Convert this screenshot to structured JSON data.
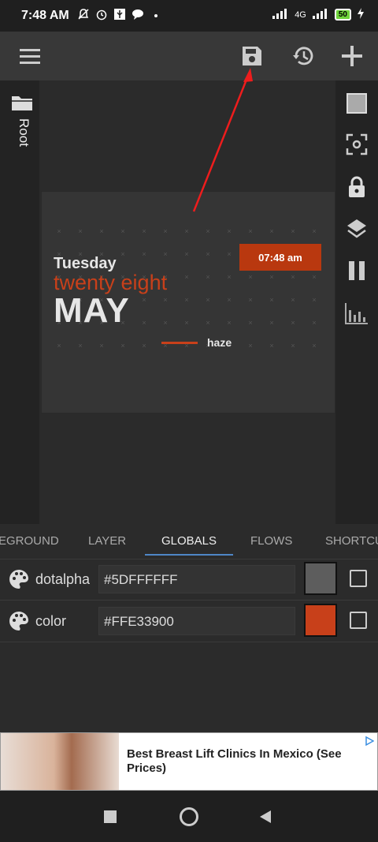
{
  "status": {
    "time": "7:48 AM",
    "network": "4G",
    "battery": "50"
  },
  "toolbar": {
    "icons": [
      "menu-icon",
      "save-icon",
      "history-icon",
      "add-icon"
    ]
  },
  "left_rail": {
    "folder_label": "Root"
  },
  "right_rail": {
    "icons": [
      "square-icon",
      "focus-icon",
      "lock-icon",
      "layers-icon",
      "pause-icon",
      "equalizer-icon"
    ]
  },
  "widget": {
    "day": "Tuesday",
    "date": "twenty eight",
    "month": "MAY",
    "clock": "07:48 am",
    "brand": "haze",
    "accent_color": "#C8401A"
  },
  "tabs": [
    {
      "label": "EGROUND",
      "active": false
    },
    {
      "label": "LAYER",
      "active": false
    },
    {
      "label": "GLOBALS",
      "active": true
    },
    {
      "label": "FLOWS",
      "active": false
    },
    {
      "label": "SHORTCU",
      "active": false
    }
  ],
  "globals": [
    {
      "name": "dotalpha",
      "value": "#5DFFFFFF",
      "swatch": "#5d5d5d"
    },
    {
      "name": "color",
      "value": "#FFE33900",
      "swatch": "#c8401a"
    }
  ],
  "ad": {
    "text": "Best Breast Lift Clinics In Mexico (See Prices)"
  }
}
